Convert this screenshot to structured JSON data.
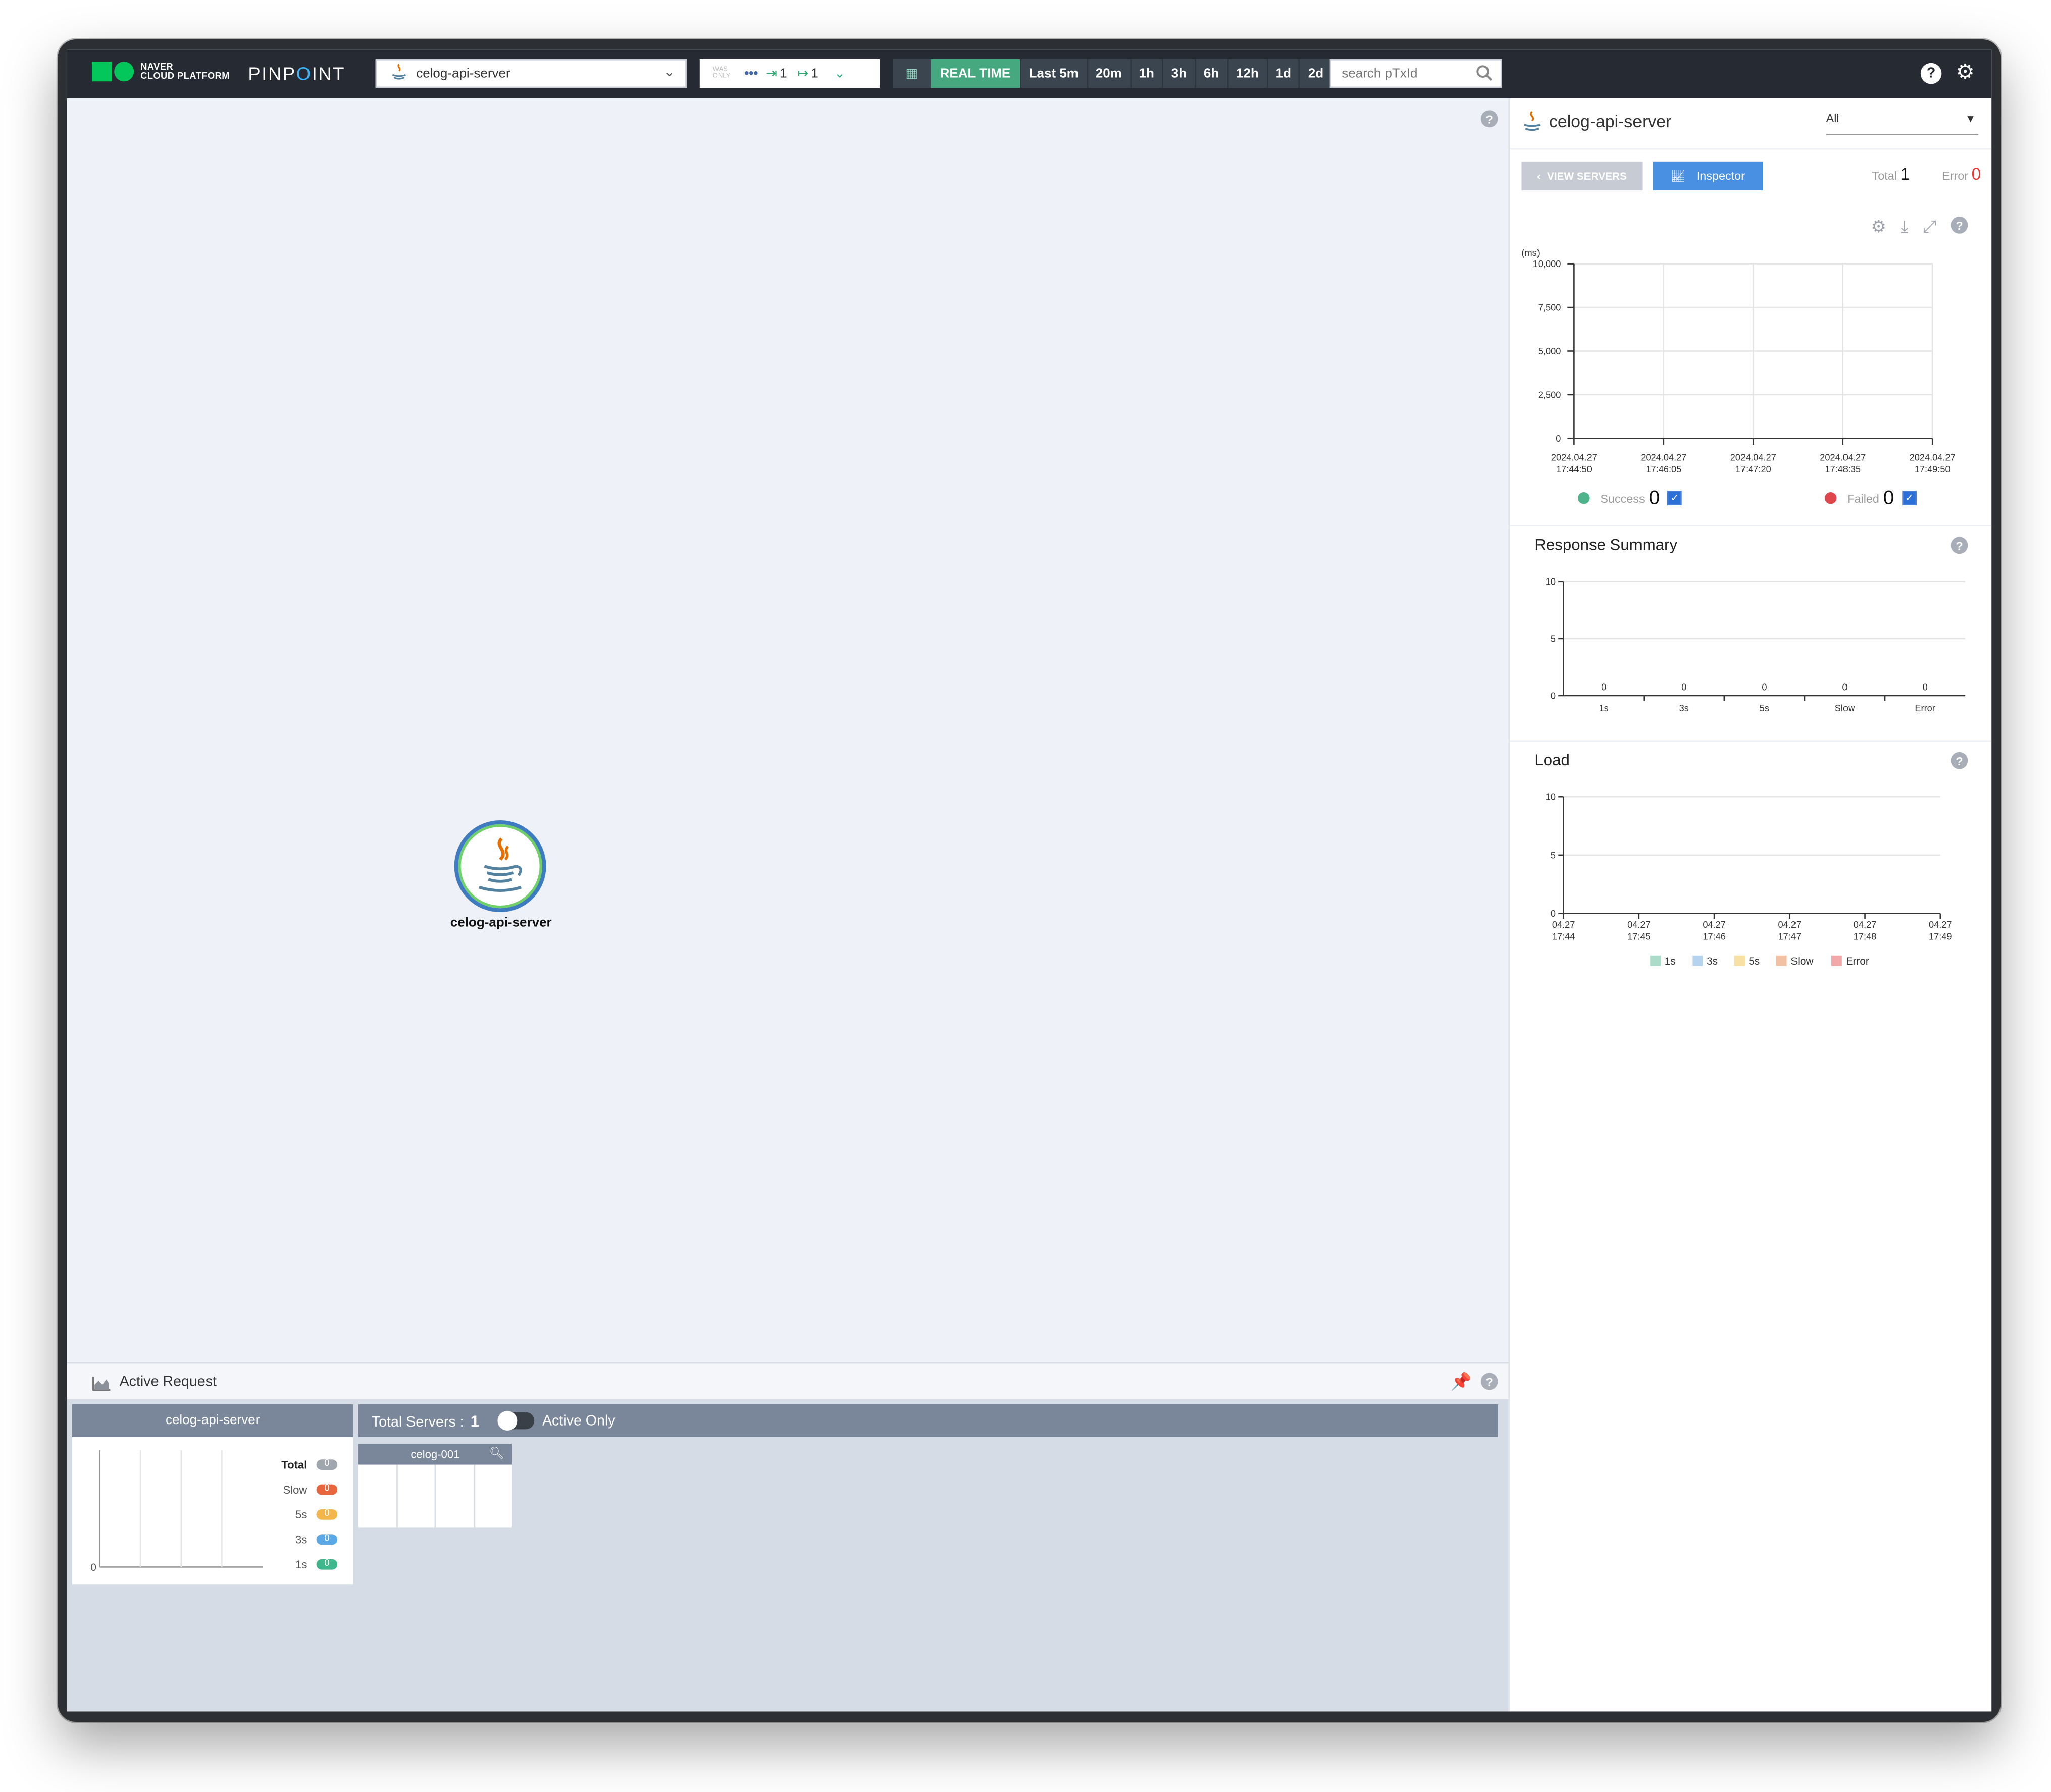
{
  "header": {
    "brand_line1": "NAVER",
    "brand_line2": "CLOUD PLATFORM",
    "product_pre": "PINP",
    "product_o": "O",
    "product_post": "INT",
    "selected_app": "celog-api-server",
    "was_only": "WAS ONLY",
    "inbound_count": "1",
    "outbound_count": "1",
    "realtime_label": "REAL TIME",
    "time_options": [
      "Last 5m",
      "20m",
      "1h",
      "3h",
      "6h",
      "12h",
      "1d",
      "2d"
    ],
    "search_placeholder": "search pTxId"
  },
  "map": {
    "node_label": "celog-api-server"
  },
  "active_request": {
    "title": "Active Request",
    "app_name": "celog-api-server",
    "total_servers_label": "Total Servers :",
    "total_servers_value": "1",
    "active_only_label": "Active Only",
    "server_name": "celog-001",
    "axis_zero": "0",
    "legend": [
      {
        "name": "Total",
        "value": "0",
        "color": "#a0a6ae"
      },
      {
        "name": "Slow",
        "value": "0",
        "color": "#e8663e"
      },
      {
        "name": "5s",
        "value": "0",
        "color": "#f2b64c"
      },
      {
        "name": "3s",
        "value": "0",
        "color": "#5aa8e6"
      },
      {
        "name": "1s",
        "value": "0",
        "color": "#3fb68b"
      }
    ]
  },
  "panel": {
    "app_name": "celog-api-server",
    "agent_select": "All",
    "view_servers": "VIEW SERVERS",
    "inspector": "Inspector",
    "total_label": "Total",
    "total_value": "1",
    "error_label": "Error",
    "error_value": "0",
    "success_label": "Success",
    "success_value": "0",
    "failed_label": "Failed",
    "failed_value": "0",
    "response_summary_title": "Response Summary",
    "load_title": "Load"
  },
  "chart_data": [
    {
      "type": "scatter",
      "title": "",
      "ylabel": "(ms)",
      "ylim": [
        0,
        10000
      ],
      "yticks": [
        "10,000",
        "7,500",
        "5,000",
        "2,500",
        "0"
      ],
      "x": [
        [
          "2024.04.27",
          "17:44:50"
        ],
        [
          "2024.04.27",
          "17:46:05"
        ],
        [
          "2024.04.27",
          "17:47:20"
        ],
        [
          "2024.04.27",
          "17:48:35"
        ],
        [
          "2024.04.27",
          "17:49:50"
        ]
      ],
      "series": [
        {
          "name": "Success",
          "values": [],
          "color": "#4fb38b"
        },
        {
          "name": "Failed",
          "values": [],
          "color": "#e0474c"
        }
      ]
    },
    {
      "type": "bar",
      "title": "Response Summary",
      "categories": [
        "1s",
        "3s",
        "5s",
        "Slow",
        "Error"
      ],
      "values": [
        0,
        0,
        0,
        0,
        0
      ],
      "ylim": [
        0,
        10
      ],
      "yticks": [
        "10",
        "5",
        "0"
      ]
    },
    {
      "type": "bar",
      "title": "Load",
      "categories": [
        [
          "04.27",
          "17:44"
        ],
        [
          "04.27",
          "17:45"
        ],
        [
          "04.27",
          "17:46"
        ],
        [
          "04.27",
          "17:47"
        ],
        [
          "04.27",
          "17:48"
        ],
        [
          "04.27",
          "17:49"
        ]
      ],
      "series": [
        {
          "name": "1s",
          "values": [],
          "color": "#a9dcc9"
        },
        {
          "name": "3s",
          "values": [],
          "color": "#b4d3ee"
        },
        {
          "name": "5s",
          "values": [],
          "color": "#f7e0a3"
        },
        {
          "name": "Slow",
          "values": [],
          "color": "#f2c0a3"
        },
        {
          "name": "Error",
          "values": [],
          "color": "#f2a8a8"
        }
      ],
      "ylim": [
        0,
        10
      ],
      "yticks": [
        "10",
        "5",
        "0"
      ]
    }
  ]
}
